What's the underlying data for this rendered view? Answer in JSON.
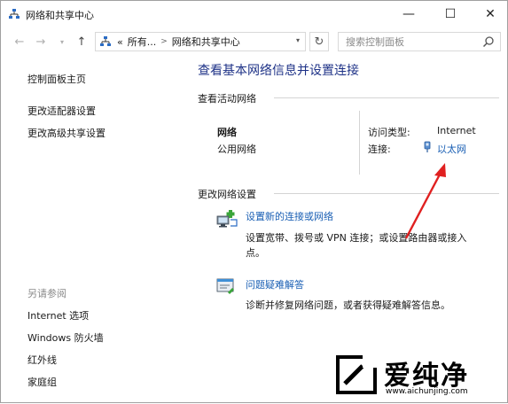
{
  "window": {
    "title": "网络和共享中心",
    "controls": {
      "minimize": "—",
      "maximize": "☐",
      "close": "✕"
    }
  },
  "address": {
    "back": "←",
    "forward": "→",
    "up": "↑",
    "breadcrumbs": [
      "«",
      "所有...",
      "网络和共享中心"
    ],
    "refresh": "↻",
    "search_placeholder": "搜索控制面板"
  },
  "sidebar": {
    "home": "控制面板主页",
    "items": [
      "更改适配器设置",
      "更改高级共享设置"
    ],
    "see_also_title": "另请参阅",
    "see_also": [
      "Internet 选项",
      "Windows 防火墙",
      "红外线",
      "家庭组"
    ]
  },
  "main": {
    "heading": "查看基本网络信息并设置连接",
    "active_networks_title": "查看活动网络",
    "network": {
      "name": "网络",
      "type": "公用网络",
      "access_type_label": "访问类型:",
      "access_type_value": "Internet",
      "connection_label": "连接:",
      "connection_value": "以太网"
    },
    "change_settings_title": "更改网络设置",
    "tasks": [
      {
        "icon": "network-setup-icon",
        "title": "设置新的连接或网络",
        "desc_line1": "设置宽带、拨号或 VPN 连接；或设置路由器或接入",
        "desc_line2": "点。"
      },
      {
        "icon": "troubleshoot-icon",
        "title": "问题疑难解答",
        "desc_line1": "诊断并修复网络问题，或者获得疑难解答信息。"
      }
    ]
  },
  "watermark": {
    "brand": "爱纯净",
    "url": "www.aichunjing.com"
  },
  "colors": {
    "heading": "#1e3287",
    "link": "#1a5fb4",
    "arrow": "#e02020",
    "watermark": "#000000"
  }
}
